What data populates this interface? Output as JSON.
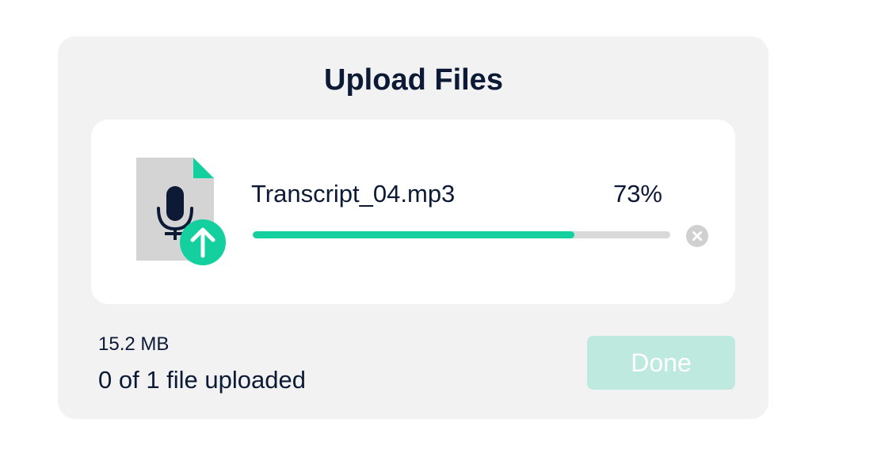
{
  "dialog": {
    "title": "Upload Files"
  },
  "file": {
    "name": "Transcript_04.mp3",
    "percent_label": "73%",
    "progress": 0.77,
    "icon": "audio-file-icon",
    "badge_icon": "upload-arrow-icon"
  },
  "footer": {
    "size": "15.2 MB",
    "status": "0 of 1 file uploaded",
    "done_label": "Done"
  },
  "colors": {
    "accent": "#14cf9e",
    "done_disabled": "#bde9de",
    "text": "#0c1a36"
  }
}
